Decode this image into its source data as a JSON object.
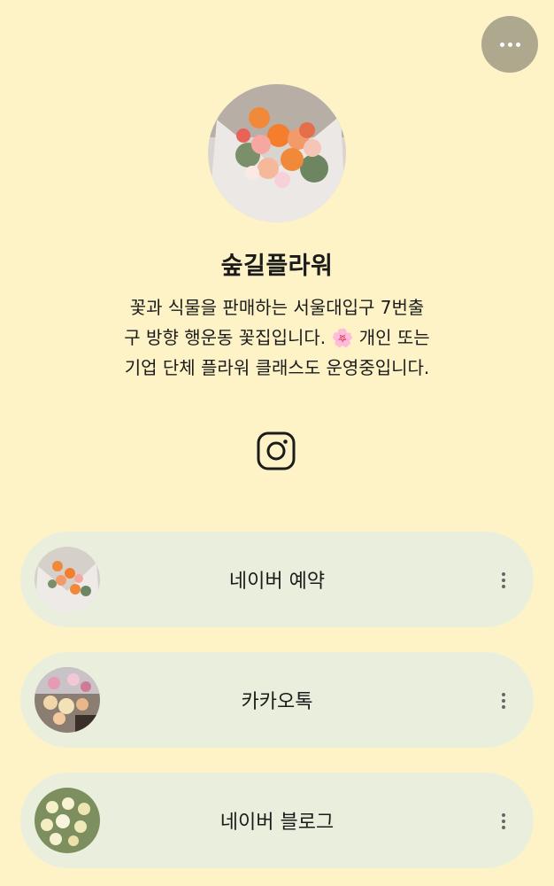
{
  "header": {
    "more_icon": "ellipsis-icon",
    "more_bg": "#aea88f"
  },
  "profile": {
    "name": "숲길플라워",
    "bio_lines": [
      "꽃과 식물을 판매하는 서울대입구 7번출",
      "구 방향 행운동 꽃집입니다. 🌸 개인 또는",
      "기업 단체 플라워 클래스도 운영중입니다."
    ],
    "avatar_image": "flower-bouquet-photo",
    "social_icon": "instagram-icon"
  },
  "links": [
    {
      "label": "네이버 예약",
      "thumb": "bouquet-photo"
    },
    {
      "label": "카카오톡",
      "thumb": "flower-shop-photo"
    },
    {
      "label": "네이버 블로그",
      "thumb": "roses-photo"
    }
  ],
  "colors": {
    "background": "#fdf3c7",
    "card": "#e9efdc",
    "text": "#1b1b1b"
  }
}
